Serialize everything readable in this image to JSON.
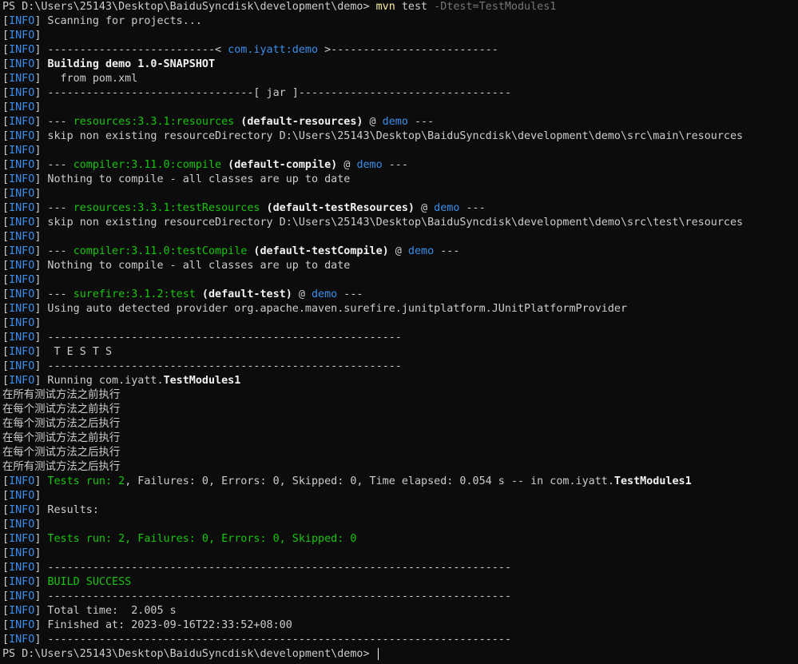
{
  "window": {
    "type": "powershell-terminal",
    "background_color": "#0c0c0c",
    "prompt": "PS D:\\Users\\25143\\Desktop\\BaiduSyncdisk\\development\\demo> "
  },
  "colors": {
    "default": "#cccccc",
    "info_tag": "#3b8eea",
    "plugin_green": "#16c60c",
    "project_blue": "#3b8eea",
    "arg_gray": "#767676",
    "command_yellow": "#f9f1a5",
    "bold_white": "#f2f2f2"
  },
  "lines": [
    [
      {
        "t": "PS D:\\Users\\25143\\Desktop\\BaiduSyncdisk\\development\\demo> ",
        "c": "default"
      },
      {
        "t": "mvn",
        "c": "yellow"
      },
      {
        "t": " test ",
        "c": "default"
      },
      {
        "t": "-Dtest=TestModules1",
        "c": "gray"
      }
    ],
    [
      {
        "t": "[",
        "c": "default"
      },
      {
        "t": "INFO",
        "c": "blue"
      },
      {
        "t": "] Scanning for projects...",
        "c": "default"
      }
    ],
    [
      {
        "t": "[",
        "c": "default"
      },
      {
        "t": "INFO",
        "c": "blue"
      },
      {
        "t": "]",
        "c": "default"
      }
    ],
    [
      {
        "t": "[",
        "c": "default"
      },
      {
        "t": "INFO",
        "c": "blue"
      },
      {
        "t": "] --------------------------< ",
        "c": "default"
      },
      {
        "t": "com.iyatt:demo",
        "c": "blue"
      },
      {
        "t": " >--------------------------",
        "c": "default"
      }
    ],
    [
      {
        "t": "[",
        "c": "default"
      },
      {
        "t": "INFO",
        "c": "blue"
      },
      {
        "t": "] ",
        "c": "default"
      },
      {
        "t": "Building demo 1.0-SNAPSHOT",
        "c": "bold"
      }
    ],
    [
      {
        "t": "[",
        "c": "default"
      },
      {
        "t": "INFO",
        "c": "blue"
      },
      {
        "t": "]   from pom.xml",
        "c": "default"
      }
    ],
    [
      {
        "t": "[",
        "c": "default"
      },
      {
        "t": "INFO",
        "c": "blue"
      },
      {
        "t": "] --------------------------------[ jar ]---------------------------------",
        "c": "default"
      }
    ],
    [
      {
        "t": "[",
        "c": "default"
      },
      {
        "t": "INFO",
        "c": "blue"
      },
      {
        "t": "]",
        "c": "default"
      }
    ],
    [
      {
        "t": "[",
        "c": "default"
      },
      {
        "t": "INFO",
        "c": "blue"
      },
      {
        "t": "] --- ",
        "c": "default"
      },
      {
        "t": "resources:3.3.1:resources",
        "c": "green"
      },
      {
        "t": " (default-resources)",
        "c": "bold"
      },
      {
        "t": " @ ",
        "c": "default"
      },
      {
        "t": "demo",
        "c": "blue"
      },
      {
        "t": " ---",
        "c": "default"
      }
    ],
    [
      {
        "t": "[",
        "c": "default"
      },
      {
        "t": "INFO",
        "c": "blue"
      },
      {
        "t": "] skip non existing resourceDirectory D:\\Users\\25143\\Desktop\\BaiduSyncdisk\\development\\demo\\src\\main\\resources",
        "c": "default"
      }
    ],
    [
      {
        "t": "[",
        "c": "default"
      },
      {
        "t": "INFO",
        "c": "blue"
      },
      {
        "t": "]",
        "c": "default"
      }
    ],
    [
      {
        "t": "[",
        "c": "default"
      },
      {
        "t": "INFO",
        "c": "blue"
      },
      {
        "t": "] --- ",
        "c": "default"
      },
      {
        "t": "compiler:3.11.0:compile",
        "c": "green"
      },
      {
        "t": " (default-compile)",
        "c": "bold"
      },
      {
        "t": " @ ",
        "c": "default"
      },
      {
        "t": "demo",
        "c": "blue"
      },
      {
        "t": " ---",
        "c": "default"
      }
    ],
    [
      {
        "t": "[",
        "c": "default"
      },
      {
        "t": "INFO",
        "c": "blue"
      },
      {
        "t": "] Nothing to compile - all classes are up to date",
        "c": "default"
      }
    ],
    [
      {
        "t": "[",
        "c": "default"
      },
      {
        "t": "INFO",
        "c": "blue"
      },
      {
        "t": "]",
        "c": "default"
      }
    ],
    [
      {
        "t": "[",
        "c": "default"
      },
      {
        "t": "INFO",
        "c": "blue"
      },
      {
        "t": "] --- ",
        "c": "default"
      },
      {
        "t": "resources:3.3.1:testResources",
        "c": "green"
      },
      {
        "t": " (default-testResources)",
        "c": "bold"
      },
      {
        "t": " @ ",
        "c": "default"
      },
      {
        "t": "demo",
        "c": "blue"
      },
      {
        "t": " ---",
        "c": "default"
      }
    ],
    [
      {
        "t": "[",
        "c": "default"
      },
      {
        "t": "INFO",
        "c": "blue"
      },
      {
        "t": "] skip non existing resourceDirectory D:\\Users\\25143\\Desktop\\BaiduSyncdisk\\development\\demo\\src\\test\\resources",
        "c": "default"
      }
    ],
    [
      {
        "t": "[",
        "c": "default"
      },
      {
        "t": "INFO",
        "c": "blue"
      },
      {
        "t": "]",
        "c": "default"
      }
    ],
    [
      {
        "t": "[",
        "c": "default"
      },
      {
        "t": "INFO",
        "c": "blue"
      },
      {
        "t": "] --- ",
        "c": "default"
      },
      {
        "t": "compiler:3.11.0:testCompile",
        "c": "green"
      },
      {
        "t": " (default-testCompile)",
        "c": "bold"
      },
      {
        "t": " @ ",
        "c": "default"
      },
      {
        "t": "demo",
        "c": "blue"
      },
      {
        "t": " ---",
        "c": "default"
      }
    ],
    [
      {
        "t": "[",
        "c": "default"
      },
      {
        "t": "INFO",
        "c": "blue"
      },
      {
        "t": "] Nothing to compile - all classes are up to date",
        "c": "default"
      }
    ],
    [
      {
        "t": "[",
        "c": "default"
      },
      {
        "t": "INFO",
        "c": "blue"
      },
      {
        "t": "]",
        "c": "default"
      }
    ],
    [
      {
        "t": "[",
        "c": "default"
      },
      {
        "t": "INFO",
        "c": "blue"
      },
      {
        "t": "] --- ",
        "c": "default"
      },
      {
        "t": "surefire:3.1.2:test",
        "c": "green"
      },
      {
        "t": " (default-test)",
        "c": "bold"
      },
      {
        "t": " @ ",
        "c": "default"
      },
      {
        "t": "demo",
        "c": "blue"
      },
      {
        "t": " ---",
        "c": "default"
      }
    ],
    [
      {
        "t": "[",
        "c": "default"
      },
      {
        "t": "INFO",
        "c": "blue"
      },
      {
        "t": "] Using auto detected provider org.apache.maven.surefire.junitplatform.JUnitPlatformProvider",
        "c": "default"
      }
    ],
    [
      {
        "t": "[",
        "c": "default"
      },
      {
        "t": "INFO",
        "c": "blue"
      },
      {
        "t": "]",
        "c": "default"
      }
    ],
    [
      {
        "t": "[",
        "c": "default"
      },
      {
        "t": "INFO",
        "c": "blue"
      },
      {
        "t": "] -------------------------------------------------------",
        "c": "default"
      }
    ],
    [
      {
        "t": "[",
        "c": "default"
      },
      {
        "t": "INFO",
        "c": "blue"
      },
      {
        "t": "]  T E S T S",
        "c": "default"
      }
    ],
    [
      {
        "t": "[",
        "c": "default"
      },
      {
        "t": "INFO",
        "c": "blue"
      },
      {
        "t": "] -------------------------------------------------------",
        "c": "default"
      }
    ],
    [
      {
        "t": "[",
        "c": "default"
      },
      {
        "t": "INFO",
        "c": "blue"
      },
      {
        "t": "] Running com.iyatt.",
        "c": "default"
      },
      {
        "t": "TestModules1",
        "c": "bold"
      }
    ],
    [
      {
        "t": "在所有测试方法之前执行",
        "c": "default"
      }
    ],
    [
      {
        "t": "在每个测试方法之前执行",
        "c": "default"
      }
    ],
    [
      {
        "t": "在每个测试方法之后执行",
        "c": "default"
      }
    ],
    [
      {
        "t": "在每个测试方法之前执行",
        "c": "default"
      }
    ],
    [
      {
        "t": "在每个测试方法之后执行",
        "c": "default"
      }
    ],
    [
      {
        "t": "在所有测试方法之后执行",
        "c": "default"
      }
    ],
    [
      {
        "t": "[",
        "c": "default"
      },
      {
        "t": "INFO",
        "c": "blue"
      },
      {
        "t": "] ",
        "c": "default"
      },
      {
        "t": "Tests run: 2",
        "c": "green"
      },
      {
        "t": ", Failures: 0, Errors: 0, Skipped: 0, Time elapsed: 0.054 s -- in com.iyatt.",
        "c": "default"
      },
      {
        "t": "TestModules1",
        "c": "bold"
      }
    ],
    [
      {
        "t": "[",
        "c": "default"
      },
      {
        "t": "INFO",
        "c": "blue"
      },
      {
        "t": "]",
        "c": "default"
      }
    ],
    [
      {
        "t": "[",
        "c": "default"
      },
      {
        "t": "INFO",
        "c": "blue"
      },
      {
        "t": "] Results:",
        "c": "default"
      }
    ],
    [
      {
        "t": "[",
        "c": "default"
      },
      {
        "t": "INFO",
        "c": "blue"
      },
      {
        "t": "]",
        "c": "default"
      }
    ],
    [
      {
        "t": "[",
        "c": "default"
      },
      {
        "t": "INFO",
        "c": "blue"
      },
      {
        "t": "] ",
        "c": "default"
      },
      {
        "t": "Tests run: 2, Failures: 0, Errors: 0, Skipped: 0",
        "c": "green"
      }
    ],
    [
      {
        "t": "[",
        "c": "default"
      },
      {
        "t": "INFO",
        "c": "blue"
      },
      {
        "t": "]",
        "c": "default"
      }
    ],
    [
      {
        "t": "[",
        "c": "default"
      },
      {
        "t": "INFO",
        "c": "blue"
      },
      {
        "t": "] ------------------------------------------------------------------------",
        "c": "default"
      }
    ],
    [
      {
        "t": "[",
        "c": "default"
      },
      {
        "t": "INFO",
        "c": "blue"
      },
      {
        "t": "] ",
        "c": "default"
      },
      {
        "t": "BUILD SUCCESS",
        "c": "green"
      }
    ],
    [
      {
        "t": "[",
        "c": "default"
      },
      {
        "t": "INFO",
        "c": "blue"
      },
      {
        "t": "] ------------------------------------------------------------------------",
        "c": "default"
      }
    ],
    [
      {
        "t": "[",
        "c": "default"
      },
      {
        "t": "INFO",
        "c": "blue"
      },
      {
        "t": "] Total time:  2.005 s",
        "c": "default"
      }
    ],
    [
      {
        "t": "[",
        "c": "default"
      },
      {
        "t": "INFO",
        "c": "blue"
      },
      {
        "t": "] Finished at: 2023-09-16T22:33:52+08:00",
        "c": "default"
      }
    ],
    [
      {
        "t": "[",
        "c": "default"
      },
      {
        "t": "INFO",
        "c": "blue"
      },
      {
        "t": "] ------------------------------------------------------------------------",
        "c": "default"
      }
    ],
    [
      {
        "t": "PS D:\\Users\\25143\\Desktop\\BaiduSyncdisk\\development\\demo> ",
        "c": "default"
      }
    ]
  ]
}
